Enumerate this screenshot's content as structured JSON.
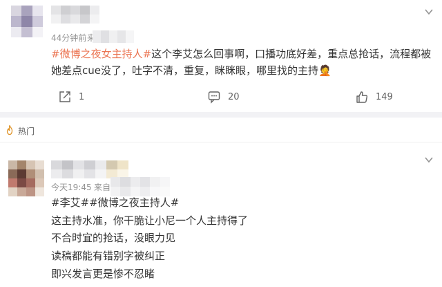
{
  "post": {
    "time": "44分钟前",
    "source_partial": "来",
    "tag": "#微博之夜女主持人#",
    "body": "这个李艾怎么回事啊，口播功底好差，重点总抢话，流程都被她差点cue没了，吐字不清，重复，眯眯眼，哪里找的主持",
    "emoji": "🤦",
    "actions": {
      "share_count": "1",
      "comment_count": "20",
      "like_count": "149"
    }
  },
  "hot_section": {
    "label": "热门"
  },
  "comment": {
    "time": "今天19:45",
    "source_partial": "来自",
    "tags": "#李艾##微博之夜主持人#",
    "lines": [
      "这主持水准，你干脆让小尼一个人主持得了",
      "不合时宜的抢话，没眼力见",
      "读稿都能有错别字被纠正",
      "即兴发言更是惨不忍睹"
    ]
  },
  "colors": {
    "accent_orange": "#eb7350",
    "meta_gray": "#939393",
    "text": "#333333",
    "divider": "#f2f2f5"
  },
  "icons": [
    "chevron-down-icon",
    "share-icon",
    "comment-icon",
    "like-icon",
    "flame-icon"
  ]
}
